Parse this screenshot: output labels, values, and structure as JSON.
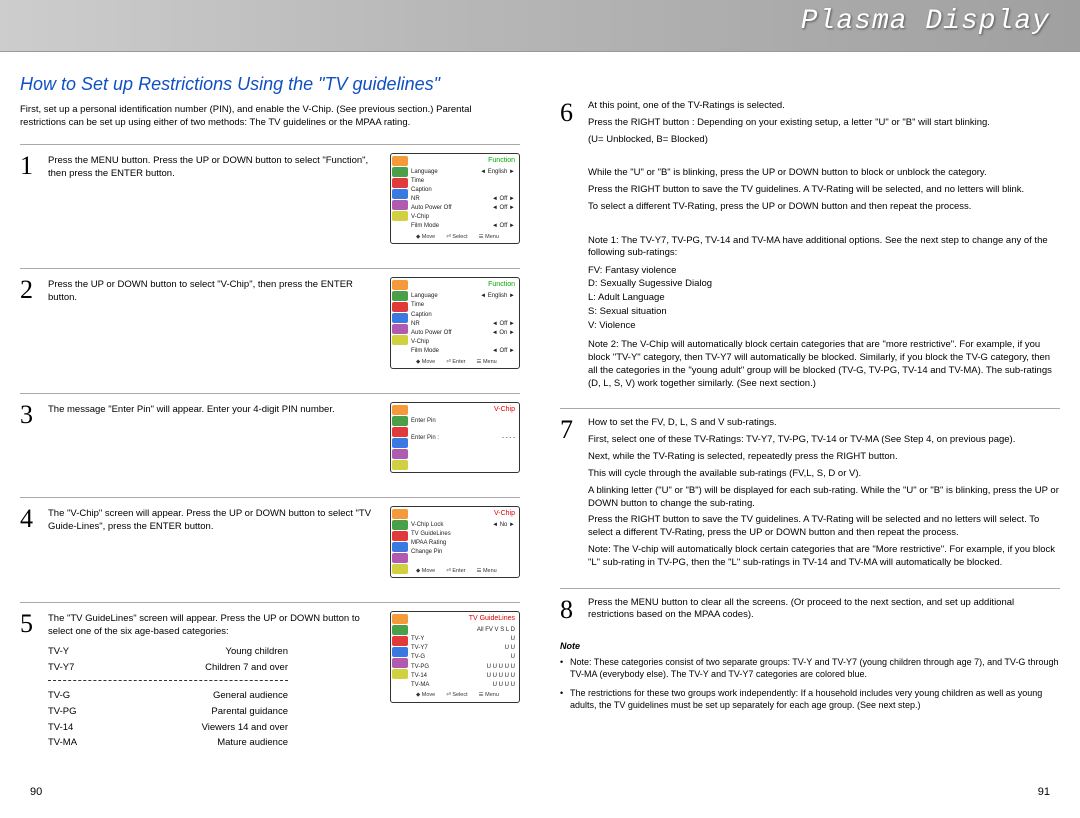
{
  "header": {
    "title": "Plasma Display"
  },
  "section_title": "How to Set up Restrictions Using the \"TV guidelines\"",
  "intro": "First, set up a personal identification number (PIN), and enable the V-Chip. (See previous section.) Parental restrictions can be set up using either of two methods: The TV guidelines or the MPAA rating.",
  "steps_left": [
    {
      "num": "1",
      "text": "Press the MENU button. Press the UP or DOWN button to select \"Function\", then press the ENTER button."
    },
    {
      "num": "2",
      "text": "Press the UP or DOWN button to select \"V-Chip\", then press the ENTER button."
    },
    {
      "num": "3",
      "text": "The message \"Enter Pin\" will appear. Enter your 4-digit PIN number."
    },
    {
      "num": "4",
      "text": "The \"V-Chip\" screen will appear. Press the UP or DOWN button to select \"TV Guide-Lines\", press the ENTER button."
    },
    {
      "num": "5",
      "text": "The \"TV GuideLines\" screen will appear. Press the UP or DOWN button to select one of the six age-based categories:"
    }
  ],
  "ratings": {
    "young": [
      {
        "code": "TV-Y",
        "desc": "Young children"
      },
      {
        "code": "TV-Y7",
        "desc": "Children 7 and over"
      }
    ],
    "general": [
      {
        "code": "TV-G",
        "desc": "General audience"
      },
      {
        "code": "TV-PG",
        "desc": "Parental guidance"
      },
      {
        "code": "TV-14",
        "desc": "Viewers 14 and over"
      },
      {
        "code": "TV-MA",
        "desc": "Mature audience"
      }
    ]
  },
  "osd": {
    "s1": {
      "title": "Function",
      "rows": [
        {
          "l": "Language",
          "r": "◄ English ►",
          "sel": true
        },
        {
          "l": "Time",
          "r": ""
        },
        {
          "l": "Caption",
          "r": ""
        },
        {
          "l": "NR",
          "r": "◄ Off ►"
        },
        {
          "l": "Auto Power Off",
          "r": "◄ Off ►"
        },
        {
          "l": "V-Chip",
          "r": ""
        },
        {
          "l": "Film Mode",
          "r": "◄ Off ►"
        }
      ],
      "foot": [
        "◆ Move",
        "⏎ Select",
        "☰ Menu"
      ]
    },
    "s2": {
      "title": "Function",
      "rows": [
        {
          "l": "Language",
          "r": "◄ English ►"
        },
        {
          "l": "Time",
          "r": ""
        },
        {
          "l": "Caption",
          "r": ""
        },
        {
          "l": "NR",
          "r": "◄ Off ►"
        },
        {
          "l": "Auto Power Off",
          "r": "◄ On ►"
        },
        {
          "l": "V-Chip",
          "r": "",
          "sel": true
        },
        {
          "l": "Film Mode",
          "r": "◄ Off ►"
        }
      ],
      "foot": [
        "◆ Move",
        "⏎ Enter",
        "☰ Menu"
      ]
    },
    "s3": {
      "title": "V-Chip",
      "rows": [
        {
          "l": "Enter Pin",
          "r": "",
          "sel": true
        },
        {
          "l": "",
          "r": ""
        },
        {
          "l": "Enter Pin :",
          "r": "- - - -"
        }
      ],
      "foot": []
    },
    "s4": {
      "title": "V-Chip",
      "rows": [
        {
          "l": "V-Chip Lock",
          "r": "◄ No ►"
        },
        {
          "l": "TV GuideLines",
          "r": "",
          "sel": true
        },
        {
          "l": "MPAA Rating",
          "r": ""
        },
        {
          "l": "Change Pin",
          "r": ""
        }
      ],
      "foot": [
        "◆ Move",
        "⏎ Enter",
        "☰ Menu"
      ]
    },
    "s5": {
      "title": "TV GuideLines",
      "hdr": "All  FV  V  S  L  D",
      "rows": [
        {
          "l": "TV-Y",
          "r": "U",
          "sel": true
        },
        {
          "l": "TV-Y7",
          "r": "U   U"
        },
        {
          "l": "TV-G",
          "r": "U"
        },
        {
          "l": "TV-PG",
          "r": "U     U  U  U  U"
        },
        {
          "l": "TV-14",
          "r": "U     U  U  U  U"
        },
        {
          "l": "TV-MA",
          "r": "U     U  U  U"
        }
      ],
      "foot": [
        "◆ Move",
        "⏎ Select",
        "☰ Menu"
      ]
    }
  },
  "steps_right": [
    {
      "num": "6",
      "paras": [
        "At this point, one of the TV-Ratings is selected.",
        "Press the RIGHT button : Depending on your existing setup, a letter \"U\" or \"B\" will start blinking.",
        "(U= Unblocked, B= Blocked)",
        "",
        "While the \"U\" or \"B\" is blinking, press the UP or DOWN button to block or unblock the category.",
        "Press the RIGHT button to save the TV guidelines. A TV-Rating will be selected, and no letters will blink.",
        "To select a different TV-Rating, press the UP or DOWN button and then repeat the process.",
        "",
        "Note 1: The TV-Y7, TV-PG, TV-14 and TV-MA have additional options. See the next step to change any of the following sub-ratings:"
      ],
      "sub_ratings": [
        "FV: Fantasy violence",
        "D:  Sexually Sugessive Dialog",
        "L:   Adult Language",
        "S:  Sexual situation",
        "V:  Violence"
      ],
      "note2": "Note 2: The V-Chip will automatically block certain categories that are \"more restrictive\". For example, if you block \"TV-Y\" category, then TV-Y7 will automatically be blocked. Similarly, if you block the TV-G category, then all the categories in the \"young adult\" group will be blocked (TV-G, TV-PG, TV-14 and TV-MA). The sub-ratings (D, L, S, V) work together similarly. (See next section.)"
    },
    {
      "num": "7",
      "paras": [
        "How to set the FV, D, L, S and V sub-ratings.",
        "First, select one of these TV-Ratings: TV-Y7, TV-PG, TV-14 or TV-MA (See Step 4, on previous page).",
        "Next, while the TV-Rating is selected, repeatedly press the RIGHT button.",
        "This will cycle through the available sub-ratings (FV,L, S, D or V).",
        "A blinking letter (\"U\" or \"B\") will be displayed for each sub-rating. While the \"U\" or \"B\" is blinking, press the UP or DOWN button to change the sub-rating.",
        "Press the RIGHT button to save the TV guidelines. A TV-Rating will be selected and no letters will select. To select a different TV-Rating, press the UP or DOWN button and then repeat the process.",
        "Note: The V-chip will automatically block certain categories that are \"More restrictive\". For example, if you block \"L\" sub-rating in TV-PG, then the \"L\" sub-ratings in TV-14 and TV-MA will automatically be blocked."
      ]
    },
    {
      "num": "8",
      "paras": [
        "Press the MENU button  to clear all the screens. (Or proceed to the next section, and set up additional restrictions based on the MPAA codes)."
      ]
    }
  ],
  "note": {
    "heading": "Note",
    "items": [
      "Note: These categories consist of two separate groups: TV-Y and TV-Y7 (young children through age 7), and TV-G through TV-MA (everybody else). The TV-Y and TV-Y7 categories are colored blue.",
      "The restrictions for these two groups work independently: If a household includes very young children as well as young adults, the TV guidelines must be set up separately for each age group. (See next step.)"
    ]
  },
  "page_numbers": {
    "left": "90",
    "right": "91"
  }
}
